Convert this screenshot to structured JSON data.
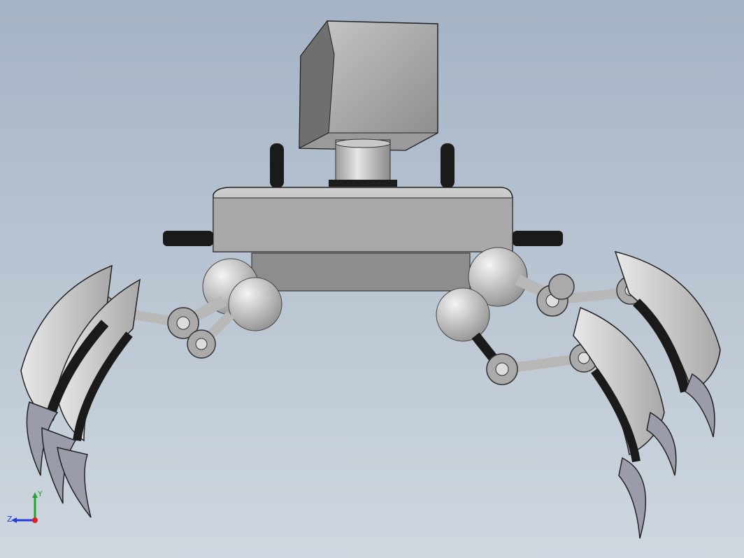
{
  "view": {
    "background_top": "#a4b3c5",
    "background_bottom": "#cfd7df"
  },
  "model": {
    "body_color": "#a8a8a8",
    "joint_color": "#b4b4b4",
    "connector_color": "#1c1c1c",
    "claw_color": "#d6d6d6",
    "talon_color": "#9a9caa"
  },
  "triad": {
    "x_label": "",
    "y_label": "Y",
    "z_label": "Z",
    "y_color": "#22a533",
    "z_color": "#2a3ad6",
    "x_color": "#e02020"
  }
}
